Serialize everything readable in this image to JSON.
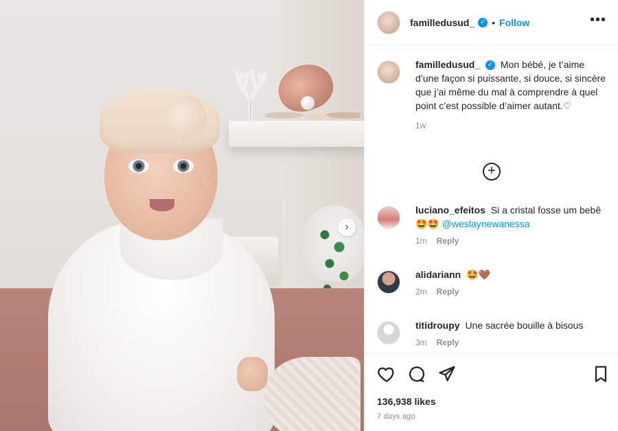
{
  "post": {
    "username": "familledusud_",
    "verified_mark": "✓",
    "dot": "•",
    "follow_label": "Follow",
    "more_label": "•••"
  },
  "caption": {
    "username": "familledusud_",
    "text": "Mon bébé, je t’aime d’une façon si puissante, si douce, si sincère que j’ai même du mal à comprendre à quel point c’est possible d’aimer autant.♡",
    "age": "1w"
  },
  "load_more": {
    "icon": "plus-circle-icon",
    "symbol": "+"
  },
  "comments": [
    {
      "username": "luciano_efeitos",
      "text": "Si a cristal fosse um bebê 🤩🤩",
      "mention": "@weslaynewanessa",
      "age": "1m",
      "reply": "Reply",
      "avatar": "red"
    },
    {
      "username": "alidariann",
      "text": "🤩🤎",
      "age": "2m",
      "reply": "Reply",
      "avatar": "dark"
    },
    {
      "username": "titidroupy",
      "text": "Une sacrée bouille à bisous",
      "age": "3m",
      "reply": "Reply",
      "avatar": "gray"
    }
  ],
  "footer": {
    "likes": "136,938 likes",
    "timestamp": "7 days ago",
    "icons": [
      "heart-icon",
      "comment-icon",
      "share-icon",
      "bookmark-icon"
    ]
  },
  "carousel": {
    "next_symbol": "›"
  },
  "colors": {
    "accent": "#0095f6",
    "text": "#262626",
    "muted": "#8e8e8e"
  }
}
